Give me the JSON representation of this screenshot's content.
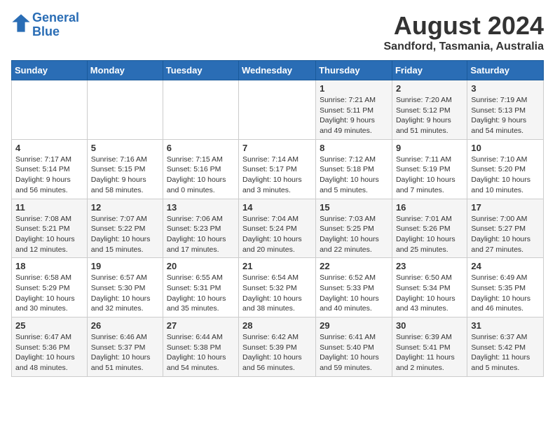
{
  "logo": {
    "line1": "General",
    "line2": "Blue"
  },
  "title": "August 2024",
  "subtitle": "Sandford, Tasmania, Australia",
  "days_of_week": [
    "Sunday",
    "Monday",
    "Tuesday",
    "Wednesday",
    "Thursday",
    "Friday",
    "Saturday"
  ],
  "weeks": [
    [
      {
        "day": "",
        "sunrise": "",
        "sunset": "",
        "daylight": ""
      },
      {
        "day": "",
        "sunrise": "",
        "sunset": "",
        "daylight": ""
      },
      {
        "day": "",
        "sunrise": "",
        "sunset": "",
        "daylight": ""
      },
      {
        "day": "",
        "sunrise": "",
        "sunset": "",
        "daylight": ""
      },
      {
        "day": "1",
        "sunrise": "Sunrise: 7:21 AM",
        "sunset": "Sunset: 5:11 PM",
        "daylight": "Daylight: 9 hours and 49 minutes."
      },
      {
        "day": "2",
        "sunrise": "Sunrise: 7:20 AM",
        "sunset": "Sunset: 5:12 PM",
        "daylight": "Daylight: 9 hours and 51 minutes."
      },
      {
        "day": "3",
        "sunrise": "Sunrise: 7:19 AM",
        "sunset": "Sunset: 5:13 PM",
        "daylight": "Daylight: 9 hours and 54 minutes."
      }
    ],
    [
      {
        "day": "4",
        "sunrise": "Sunrise: 7:17 AM",
        "sunset": "Sunset: 5:14 PM",
        "daylight": "Daylight: 9 hours and 56 minutes."
      },
      {
        "day": "5",
        "sunrise": "Sunrise: 7:16 AM",
        "sunset": "Sunset: 5:15 PM",
        "daylight": "Daylight: 9 hours and 58 minutes."
      },
      {
        "day": "6",
        "sunrise": "Sunrise: 7:15 AM",
        "sunset": "Sunset: 5:16 PM",
        "daylight": "Daylight: 10 hours and 0 minutes."
      },
      {
        "day": "7",
        "sunrise": "Sunrise: 7:14 AM",
        "sunset": "Sunset: 5:17 PM",
        "daylight": "Daylight: 10 hours and 3 minutes."
      },
      {
        "day": "8",
        "sunrise": "Sunrise: 7:12 AM",
        "sunset": "Sunset: 5:18 PM",
        "daylight": "Daylight: 10 hours and 5 minutes."
      },
      {
        "day": "9",
        "sunrise": "Sunrise: 7:11 AM",
        "sunset": "Sunset: 5:19 PM",
        "daylight": "Daylight: 10 hours and 7 minutes."
      },
      {
        "day": "10",
        "sunrise": "Sunrise: 7:10 AM",
        "sunset": "Sunset: 5:20 PM",
        "daylight": "Daylight: 10 hours and 10 minutes."
      }
    ],
    [
      {
        "day": "11",
        "sunrise": "Sunrise: 7:08 AM",
        "sunset": "Sunset: 5:21 PM",
        "daylight": "Daylight: 10 hours and 12 minutes."
      },
      {
        "day": "12",
        "sunrise": "Sunrise: 7:07 AM",
        "sunset": "Sunset: 5:22 PM",
        "daylight": "Daylight: 10 hours and 15 minutes."
      },
      {
        "day": "13",
        "sunrise": "Sunrise: 7:06 AM",
        "sunset": "Sunset: 5:23 PM",
        "daylight": "Daylight: 10 hours and 17 minutes."
      },
      {
        "day": "14",
        "sunrise": "Sunrise: 7:04 AM",
        "sunset": "Sunset: 5:24 PM",
        "daylight": "Daylight: 10 hours and 20 minutes."
      },
      {
        "day": "15",
        "sunrise": "Sunrise: 7:03 AM",
        "sunset": "Sunset: 5:25 PM",
        "daylight": "Daylight: 10 hours and 22 minutes."
      },
      {
        "day": "16",
        "sunrise": "Sunrise: 7:01 AM",
        "sunset": "Sunset: 5:26 PM",
        "daylight": "Daylight: 10 hours and 25 minutes."
      },
      {
        "day": "17",
        "sunrise": "Sunrise: 7:00 AM",
        "sunset": "Sunset: 5:27 PM",
        "daylight": "Daylight: 10 hours and 27 minutes."
      }
    ],
    [
      {
        "day": "18",
        "sunrise": "Sunrise: 6:58 AM",
        "sunset": "Sunset: 5:29 PM",
        "daylight": "Daylight: 10 hours and 30 minutes."
      },
      {
        "day": "19",
        "sunrise": "Sunrise: 6:57 AM",
        "sunset": "Sunset: 5:30 PM",
        "daylight": "Daylight: 10 hours and 32 minutes."
      },
      {
        "day": "20",
        "sunrise": "Sunrise: 6:55 AM",
        "sunset": "Sunset: 5:31 PM",
        "daylight": "Daylight: 10 hours and 35 minutes."
      },
      {
        "day": "21",
        "sunrise": "Sunrise: 6:54 AM",
        "sunset": "Sunset: 5:32 PM",
        "daylight": "Daylight: 10 hours and 38 minutes."
      },
      {
        "day": "22",
        "sunrise": "Sunrise: 6:52 AM",
        "sunset": "Sunset: 5:33 PM",
        "daylight": "Daylight: 10 hours and 40 minutes."
      },
      {
        "day": "23",
        "sunrise": "Sunrise: 6:50 AM",
        "sunset": "Sunset: 5:34 PM",
        "daylight": "Daylight: 10 hours and 43 minutes."
      },
      {
        "day": "24",
        "sunrise": "Sunrise: 6:49 AM",
        "sunset": "Sunset: 5:35 PM",
        "daylight": "Daylight: 10 hours and 46 minutes."
      }
    ],
    [
      {
        "day": "25",
        "sunrise": "Sunrise: 6:47 AM",
        "sunset": "Sunset: 5:36 PM",
        "daylight": "Daylight: 10 hours and 48 minutes."
      },
      {
        "day": "26",
        "sunrise": "Sunrise: 6:46 AM",
        "sunset": "Sunset: 5:37 PM",
        "daylight": "Daylight: 10 hours and 51 minutes."
      },
      {
        "day": "27",
        "sunrise": "Sunrise: 6:44 AM",
        "sunset": "Sunset: 5:38 PM",
        "daylight": "Daylight: 10 hours and 54 minutes."
      },
      {
        "day": "28",
        "sunrise": "Sunrise: 6:42 AM",
        "sunset": "Sunset: 5:39 PM",
        "daylight": "Daylight: 10 hours and 56 minutes."
      },
      {
        "day": "29",
        "sunrise": "Sunrise: 6:41 AM",
        "sunset": "Sunset: 5:40 PM",
        "daylight": "Daylight: 10 hours and 59 minutes."
      },
      {
        "day": "30",
        "sunrise": "Sunrise: 6:39 AM",
        "sunset": "Sunset: 5:41 PM",
        "daylight": "Daylight: 11 hours and 2 minutes."
      },
      {
        "day": "31",
        "sunrise": "Sunrise: 6:37 AM",
        "sunset": "Sunset: 5:42 PM",
        "daylight": "Daylight: 11 hours and 5 minutes."
      }
    ]
  ]
}
